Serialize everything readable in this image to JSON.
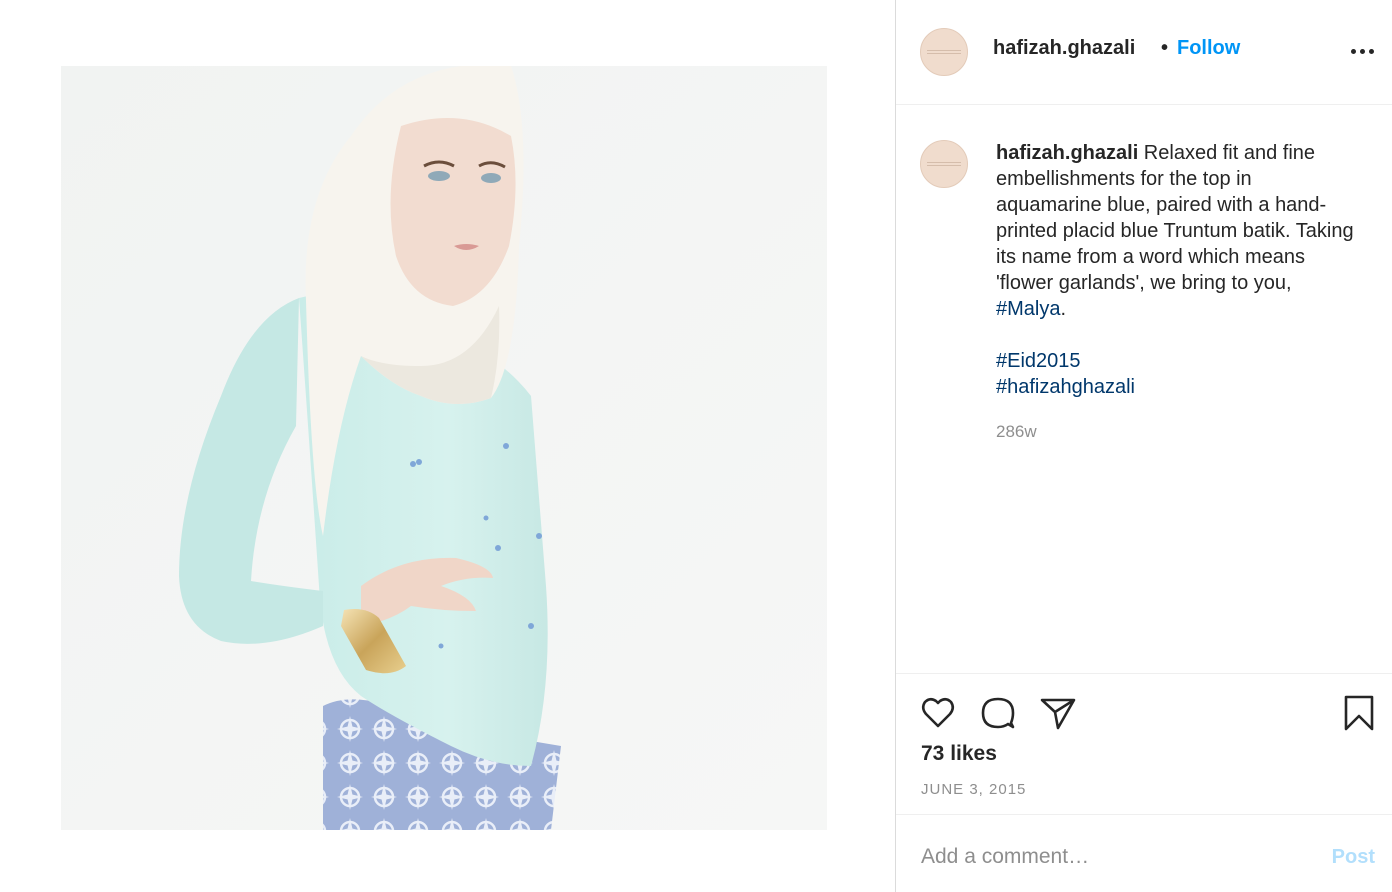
{
  "post": {
    "image_alt": "Model wearing a white hijab, aquamarine embellished top and blue batik skirt",
    "header": {
      "username": "hafizah.ghazali",
      "separator": "•",
      "follow_label": "Follow",
      "more_icon": "more-horizontal-icon"
    },
    "caption": {
      "username": "hafizah.ghazali",
      "text": " Relaxed fit and fine embellishments for the top in aquamarine blue, paired with a hand-printed placid blue Truntum batik. Taking its name from a word which means 'flower garlands', we bring to you, ",
      "tag_malya": "#Malya",
      "period": ".",
      "tag_eid": "#Eid2015",
      "tag_brand": "#hafizahghazali",
      "age": "286w"
    },
    "actions": {
      "like_icon": "heart-icon",
      "comment_icon": "comment-bubble-icon",
      "share_icon": "paper-plane-icon",
      "save_icon": "bookmark-icon"
    },
    "likes": "73 likes",
    "date": "JUNE 3, 2015",
    "comment": {
      "placeholder": "Add a comment…",
      "post_label": "Post"
    },
    "colors": {
      "link_blue": "#0095f6",
      "hashtag_blue": "#00376b",
      "post_disabled": "#b2dffc",
      "muted": "#8e8e8e"
    }
  }
}
